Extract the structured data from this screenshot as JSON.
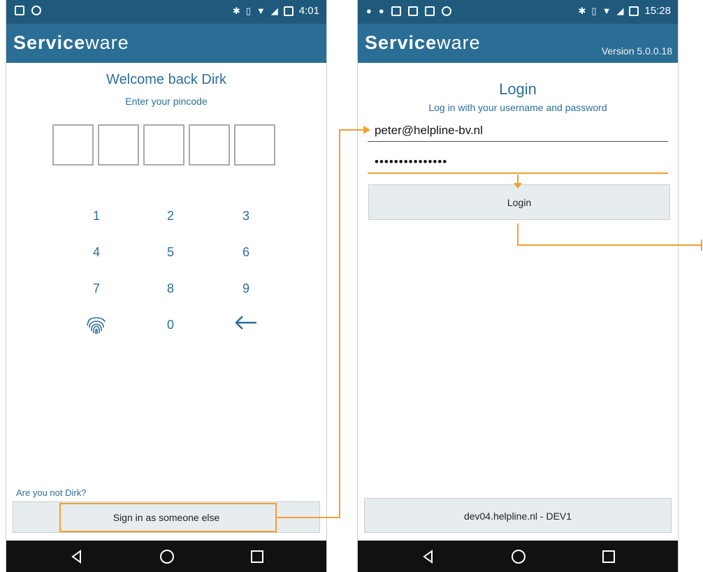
{
  "left_screen": {
    "status_time": "4:01",
    "brand_bold": "Service",
    "brand_light": "ware",
    "welcome": "Welcome back Dirk",
    "subtitle": "Enter your pincode",
    "pin_slots": 5,
    "keypad": [
      "1",
      "2",
      "3",
      "4",
      "5",
      "6",
      "7",
      "8",
      "9",
      "",
      "0",
      ""
    ],
    "fingerprint_icon": "fingerprint-icon",
    "backspace_icon": "backspace-arrow-icon",
    "not_user_link": "Are you not Dirk?",
    "sign_in_other_button": "Sign in as someone else"
  },
  "right_screen": {
    "status_time": "15:28",
    "brand_bold": "Service",
    "brand_light": "ware",
    "version": "Version 5.0.0.18",
    "title": "Login",
    "subtitle": "Log in with your username and password",
    "username_value": "peter@helpline-bv.nl",
    "password_value": "•••••••••••••••",
    "login_button": "Login",
    "server_button": "dev04.helpline.nl - DEV1"
  },
  "colors": {
    "statusbar": "#1f5a7d",
    "appbar": "#2a6e96",
    "accent_text": "#2b6f99",
    "annotation": "#f0a030"
  }
}
